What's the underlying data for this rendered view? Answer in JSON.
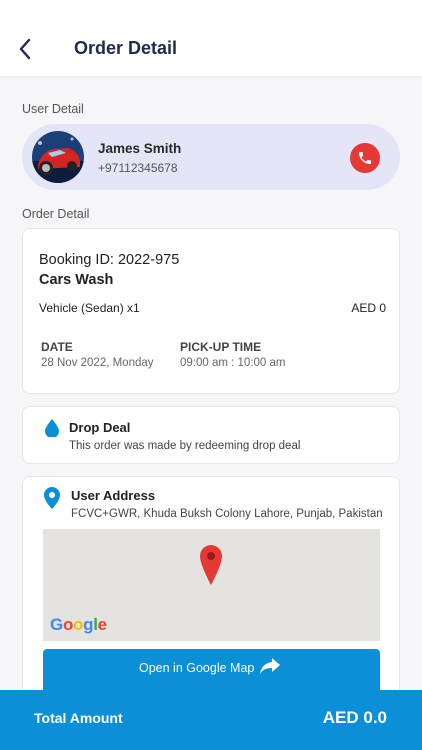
{
  "header": {
    "title": "Order Detail",
    "back_icon": "chevron-left-icon"
  },
  "user_section": {
    "label": "User Detail",
    "name": "James Smith",
    "phone": "+97112345678",
    "call_icon": "phone-icon"
  },
  "order_section": {
    "label": "Order Detail",
    "booking_id": "Booking ID: 2022-975",
    "service": "Cars Wash",
    "vehicle": "Vehicle (Sedan) x1",
    "vehicle_price": "AED 0",
    "date_label": "DATE",
    "date_value": "28 Nov 2022, Monday",
    "time_label": "PICK-UP TIME",
    "time_value": "09:00 am : 10:00 am"
  },
  "drop_deal": {
    "title": "Drop Deal",
    "description": "This order was made by redeeming drop deal",
    "icon": "water-drop-icon"
  },
  "address": {
    "title": "User Address",
    "text": "FCVC+GWR, Khuda Buksh Colony Lahore, Punjab, Pakistan",
    "map_logo": "Google",
    "button_label": "Open in Google Map",
    "button_icon": "share-arrow-icon"
  },
  "footer": {
    "label": "Total Amount",
    "value": "AED 0.0"
  },
  "colors": {
    "primary": "#0b8fd6",
    "call": "#e53935",
    "title": "#1f2a4d",
    "user_card_bg": "#e4e6f7"
  }
}
